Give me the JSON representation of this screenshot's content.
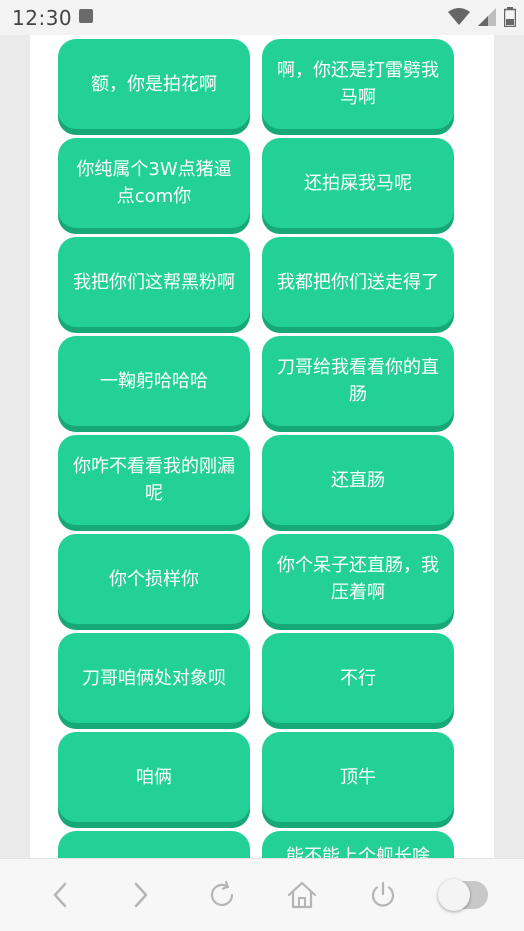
{
  "status": {
    "time": "12:30"
  },
  "phrases": [
    "额，你是拍花啊",
    "啊，你还是打雷劈我马啊",
    "你纯属个3W点猪逼点com你",
    "还拍屎我马呢",
    "我把你们这帮黑粉啊",
    "我都把你们送走得了",
    "一鞠躬哈哈哈",
    "刀哥给我看看你的直肠",
    "你咋不看看我的刚漏呢",
    "还直肠",
    "你个损样你",
    "你个呆子还直肠，我压着啊",
    "刀哥咱俩处对象呗",
    "不行",
    "咱俩",
    "顶牛",
    "",
    "能不能上个舰长啥"
  ],
  "colors": {
    "button": "#23d197",
    "button_shadow": "#17a877"
  },
  "nav": {
    "icons": [
      "back-icon",
      "forward-icon",
      "reload-icon",
      "home-icon",
      "power-icon",
      "toggle-switch"
    ]
  }
}
